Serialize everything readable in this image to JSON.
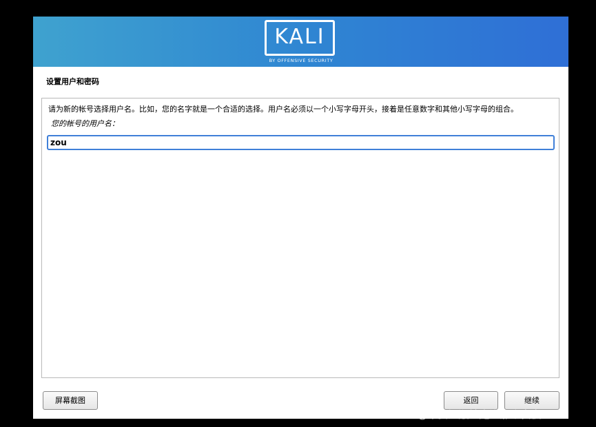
{
  "banner": {
    "logo_text": "KALI",
    "logo_subtext": "BY OFFENSIVE SECURITY",
    "gradient_start": "#3fa2cf",
    "gradient_end": "#2f6fd6"
  },
  "section_title": "设置用户和密码",
  "panel": {
    "instructions": "请为新的帐号选择用户名。比如，您的名字就是一个合适的选择。用户名必须以一个小写字母开头，接着是任意数字和其他小写字母的组合。",
    "field_label": "您的帐号的用户名：",
    "username_value": "zou"
  },
  "buttons": {
    "screenshot_label": "屏幕截图",
    "back_label": "返回",
    "continue_label": "继续"
  },
  "watermark": "CSDN @不要温顺地走进那个良夜",
  "colors": {
    "input_focus_border": "#3f7fd8",
    "background": "#000000"
  }
}
